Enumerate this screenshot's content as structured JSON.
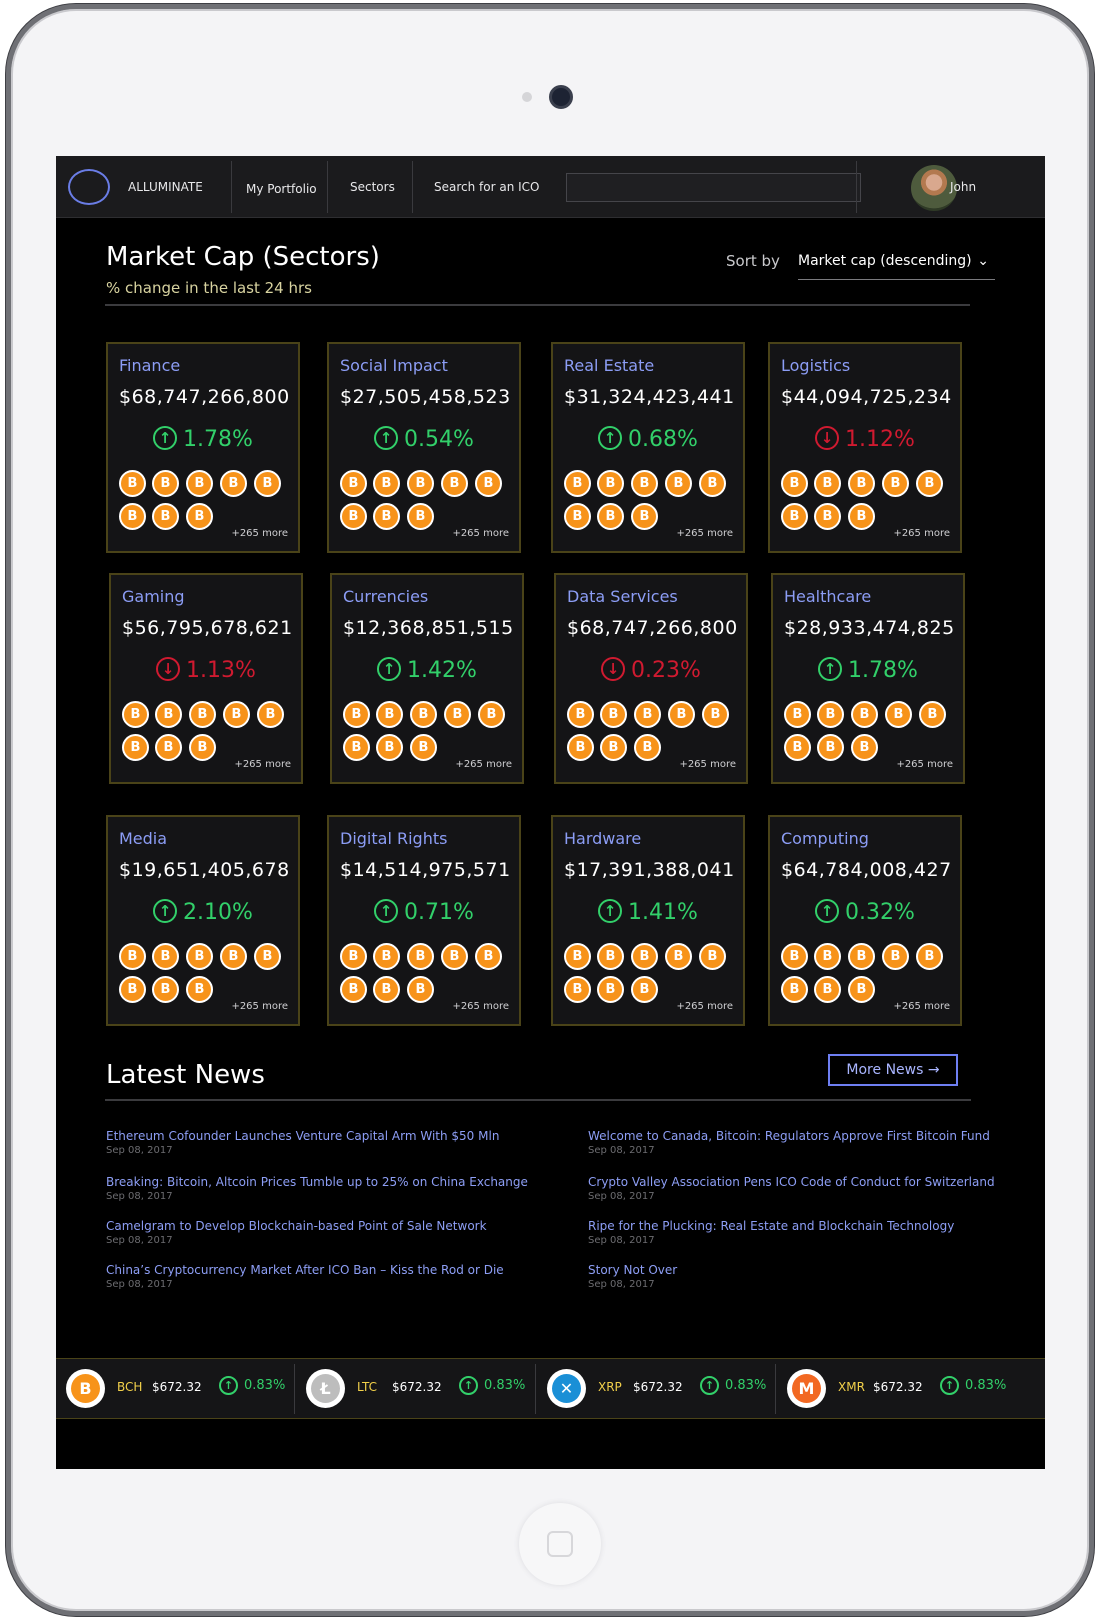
{
  "nav": {
    "brand": "ALLUMINATE",
    "portfolio": "My Portfolio",
    "sectors": "Sectors",
    "search_label": "Search for an ICO",
    "search_value": "",
    "user_name": "John"
  },
  "header": {
    "title": "Market Cap (Sectors)",
    "subtitle": "% change in the last 24 hrs",
    "sort_label": "Sort by",
    "sort_value": "Market cap (descending)"
  },
  "sectors": [
    {
      "name": "Finance",
      "value": "$68,747,266,800",
      "change": "1.78%",
      "direction": "up",
      "more": "+265 more"
    },
    {
      "name": "Social Impact",
      "value": "$27,505,458,523",
      "change": "0.54%",
      "direction": "up",
      "more": "+265 more"
    },
    {
      "name": "Real Estate",
      "value": "$31,324,423,441",
      "change": "0.68%",
      "direction": "up",
      "more": "+265 more"
    },
    {
      "name": "Logistics",
      "value": "$44,094,725,234",
      "change": "1.12%",
      "direction": "down",
      "more": "+265 more"
    },
    {
      "name": "Gaming",
      "value": "$56,795,678,621",
      "change": "1.13%",
      "direction": "down",
      "more": "+265 more"
    },
    {
      "name": "Currencies",
      "value": "$12,368,851,515",
      "change": "1.42%",
      "direction": "up",
      "more": "+265 more"
    },
    {
      "name": "Data Services",
      "value": "$68,747,266,800",
      "change": "0.23%",
      "direction": "down",
      "more": "+265 more"
    },
    {
      "name": "Healthcare",
      "value": "$28,933,474,825",
      "change": "1.78%",
      "direction": "up",
      "more": "+265 more"
    },
    {
      "name": "Media",
      "value": "$19,651,405,678",
      "change": "2.10%",
      "direction": "up",
      "more": "+265 more"
    },
    {
      "name": "Digital Rights",
      "value": "$14,514,975,571",
      "change": "0.71%",
      "direction": "up",
      "more": "+265 more"
    },
    {
      "name": "Hardware",
      "value": "$17,391,388,041",
      "change": "1.41%",
      "direction": "up",
      "more": "+265 more"
    },
    {
      "name": "Computing",
      "value": "$64,784,008,427",
      "change": "0.32%",
      "direction": "up",
      "more": "+265 more"
    }
  ],
  "news": {
    "title": "Latest News",
    "more_label": "More News →",
    "left": [
      {
        "title": "Ethereum Cofounder Launches Venture Capital Arm With $50 Mln",
        "date": "Sep 08, 2017"
      },
      {
        "title": "Breaking: Bitcoin, Altcoin Prices Tumble up to 25% on China Exchange",
        "date": "Sep 08, 2017"
      },
      {
        "title": "Camelgram to Develop Blockchain-based Point of Sale Network",
        "date": "Sep 08, 2017"
      },
      {
        "title": "China’s Cryptocurrency Market After ICO Ban – Kiss the Rod or Die",
        "date": "Sep 08, 2017"
      }
    ],
    "right": [
      {
        "title": "Welcome to Canada, Bitcoin: Regulators Approve First Bitcoin Fund",
        "date": "Sep 08, 2017"
      },
      {
        "title": "Crypto Valley Association Pens ICO Code of Conduct for Switzerland",
        "date": "Sep 08, 2017"
      },
      {
        "title": "Ripe for the Plucking: Real Estate and Blockchain Technology",
        "date": "Sep 08, 2017"
      },
      {
        "title": "Story Not Over",
        "date": "Sep 08, 2017"
      }
    ]
  },
  "ticker": [
    {
      "symbol": "BCH",
      "price": "$672.32",
      "change": "0.83%",
      "icon": "bitcoin-icon",
      "color": "#f7931a"
    },
    {
      "symbol": "LTC",
      "price": "$672.32",
      "change": "0.83%",
      "icon": "litecoin-icon",
      "color": "#bdbdbd"
    },
    {
      "symbol": "XRP",
      "price": "$672.32",
      "change": "0.83%",
      "icon": "ripple-icon",
      "color": "#1a8fd6"
    },
    {
      "symbol": "XMR",
      "price": "$672.32",
      "change": "0.83%",
      "icon": "monero-icon",
      "color": "#f26822"
    }
  ],
  "colors": {
    "up": "#32d06a",
    "down": "#d01a30",
    "accent": "#8c9df5",
    "gold_border": "#4a4318"
  }
}
